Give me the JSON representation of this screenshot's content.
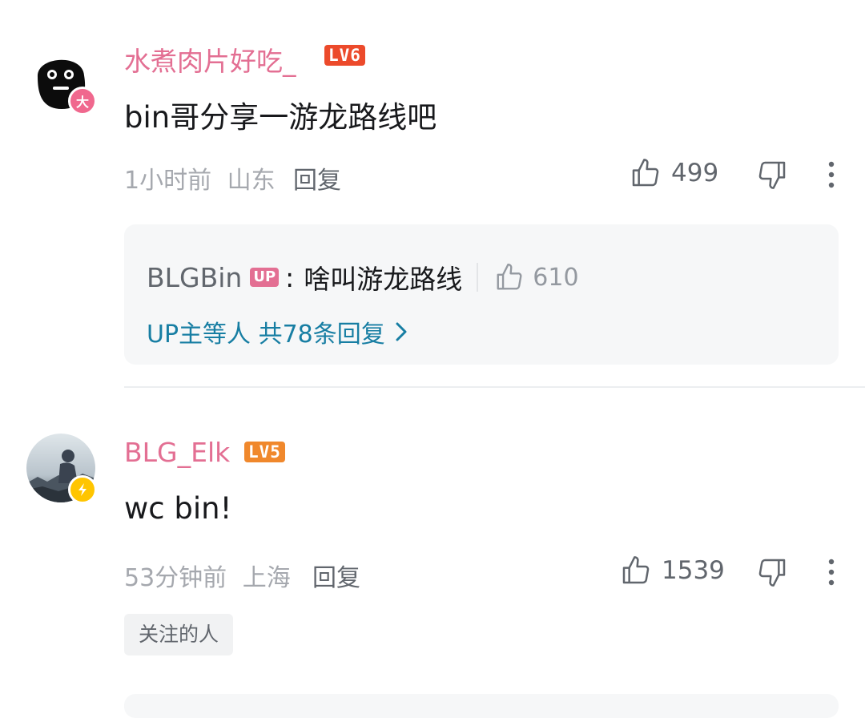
{
  "comments": [
    {
      "username": "水煮肉片好吃_",
      "level": "LV6",
      "badge": "大",
      "text": "bin哥分享一游龙路线吧",
      "time": "1小时前",
      "location": "山东",
      "reply_label": "回复",
      "likes": "499",
      "sub_reply": {
        "name": "BLGBin",
        "up_tag": "UP",
        "separator": ":",
        "text": "啥叫游龙路线",
        "likes": "610",
        "more_label": "UP主等人 共78条回复"
      }
    },
    {
      "username": "BLG_Elk",
      "level": "LV5",
      "text": "wc bin!",
      "time": "53分钟前",
      "location": "上海",
      "reply_label": "回复",
      "likes": "1539",
      "tag": "关注的人"
    }
  ],
  "colors": {
    "username": "#e36f93",
    "link": "#177ea3",
    "meta": "#a5a8ae",
    "lv6": "#ec4a2b",
    "lv5": "#f0882c"
  }
}
